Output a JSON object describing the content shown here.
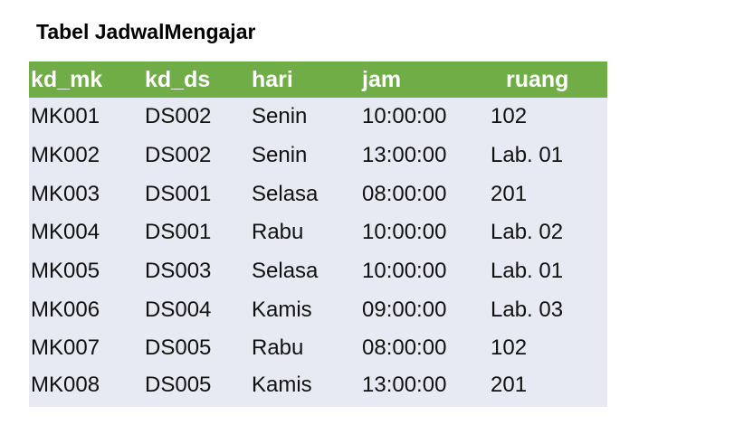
{
  "title": "Tabel JadwalMengajar",
  "table": {
    "headers": [
      "kd_mk",
      "kd_ds",
      "hari",
      "jam",
      "ruang"
    ],
    "rows": [
      [
        "MK001",
        "DS002",
        "Senin",
        "10:00:00",
        "102"
      ],
      [
        "MK002",
        "DS002",
        "Senin",
        "13:00:00",
        "Lab. 01"
      ],
      [
        "MK003",
        "DS001",
        "Selasa",
        "08:00:00",
        "201"
      ],
      [
        "MK004",
        "DS001",
        "Rabu",
        "10:00:00",
        "Lab. 02"
      ],
      [
        "MK005",
        "DS003",
        "Selasa",
        "10:00:00",
        "Lab. 01"
      ],
      [
        "MK006",
        "DS004",
        "Kamis",
        "09:00:00",
        "Lab. 03"
      ],
      [
        "MK007",
        "DS005",
        "Rabu",
        "08:00:00",
        "102"
      ],
      [
        "MK008",
        "DS005",
        "Kamis",
        "13:00:00",
        "201"
      ]
    ]
  },
  "colors": {
    "header_background": "#70ad47",
    "body_background": "#e8eaf3",
    "header_text": "#ffffff"
  }
}
